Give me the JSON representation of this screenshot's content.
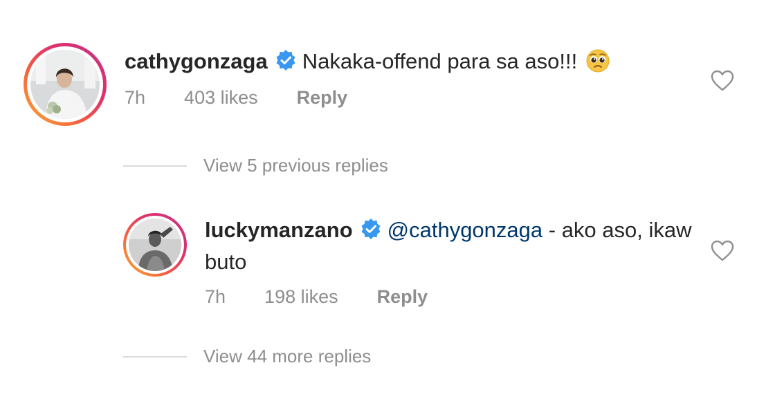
{
  "comments": [
    {
      "username": "cathygonzaga",
      "text": "Nakaka-offend para sa aso!!!",
      "emoji": "🥺",
      "time": "7h",
      "likes": "403 likes",
      "reply": "Reply"
    },
    {
      "username": "luckymanzano",
      "mention": "@cathygonzaga",
      "text": " - ako aso, ikaw buto",
      "time": "7h",
      "likes": "198 likes",
      "reply": "Reply"
    }
  ],
  "view_previous": "View 5 previous replies",
  "view_more": "View 44 more replies",
  "icons": {
    "verified": "verified-badge-icon",
    "like": "heart-icon"
  },
  "colors": {
    "verified_blue": "#3897f0",
    "mention": "#00376b",
    "muted": "#8e8e8e"
  }
}
